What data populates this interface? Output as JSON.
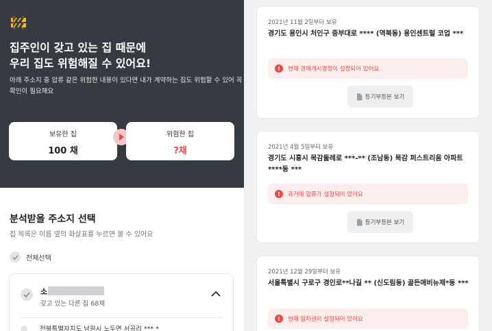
{
  "banner": {
    "headline_line1": "집주인이 갖고 있는 집 때문에",
    "headline_line2": "우리 집도 위험해질 수 있어요!",
    "description": "아래 주소지 중 압류 같은 위험한 내용이 있다면 내가 계약하는 집도 위험할 수 있어 꼭 확인이 필요해요",
    "icon": "construction-barrier-icon",
    "owned": {
      "label": "보유한 집",
      "value": "100 채"
    },
    "risky": {
      "label": "위험한 집",
      "value": "?채"
    }
  },
  "section": {
    "title": "분석받을 주소지 선택",
    "subtitle": "집 목록은 이름 옆의 화살표를 누르면 볼 수 있어요",
    "select_all": "전체선택"
  },
  "address_group": {
    "name": "소",
    "count_text": "갖고 있는 다른 집 68채",
    "next_item": "전북특별자치도 남원시 노두면 서곡리 *** *"
  },
  "properties": [
    {
      "date": "2021년 11월 2일부터 보유",
      "address": "경기도 용인시 처인구 중부대로 **** (역북동) 용인센트럴 코업 ***",
      "alert": "현재 경매개시결정이 설정되어 있어요",
      "button": "등기부등본 보기"
    },
    {
      "date": "2021년 4월 5일부터 보유",
      "address": "경기도 시흥시 목감둘레로 ***-** (조남동) 목감 퍼스트리움 아파트 ****동 ***",
      "alert": "과거에 압류가 설정되어 있어요",
      "button": "등기부등본 보기"
    },
    {
      "date": "2021년 12월 29일부터 보유",
      "address": "서울특별시 구로구 경인로**나길 ** (신도림동) 골든애비뉴제*동 ***",
      "alert": "현재 임차권이 설정되어 있어요",
      "button": ""
    }
  ],
  "colors": {
    "dark_panel": "#363b42",
    "danger": "#e84b4b",
    "alert_bg": "#fdeeee"
  }
}
